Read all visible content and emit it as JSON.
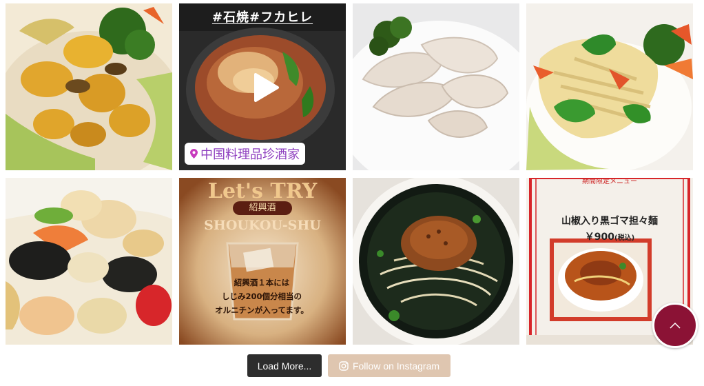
{
  "feed": {
    "tiles": [
      {
        "kind": "photo",
        "icon": "abalone-dish"
      },
      {
        "kind": "video",
        "hashtag": "#石焼#フカヒレ",
        "location": "中国料理品珍酒家",
        "icon": "shark-fin-stone-pot"
      },
      {
        "kind": "photo",
        "icon": "gyoza-dumplings"
      },
      {
        "kind": "photo",
        "icon": "tofu-skin-salad"
      },
      {
        "kind": "photo",
        "icon": "squid-stir-fry"
      },
      {
        "kind": "photo",
        "title": "Let's TRY",
        "badge": "紹興酒",
        "subtitle": "SHOUKOU-SHU",
        "note_lines": [
          "紹興酒１本には",
          "しじみ200個分相当の",
          "オルニチンが入ってます。"
        ],
        "icon": "shaoxing-wine-glass"
      },
      {
        "kind": "photo",
        "icon": "black-sesame-dandan-noodles"
      },
      {
        "kind": "photo",
        "top_text": "期間限定メニュー",
        "menu_title": "山椒入り黒ゴマ担々麺",
        "price": "￥900",
        "price_note": "(税込)",
        "icon": "menu-card"
      }
    ]
  },
  "actions": {
    "load_more_label": "Load More...",
    "follow_label": "Follow on Instagram"
  },
  "colors": {
    "load_more_bg": "#2d2d2d",
    "follow_bg": "#dfc6b0",
    "scroll_top_bg": "#8b1235",
    "location_text": "#8e3fbf"
  }
}
